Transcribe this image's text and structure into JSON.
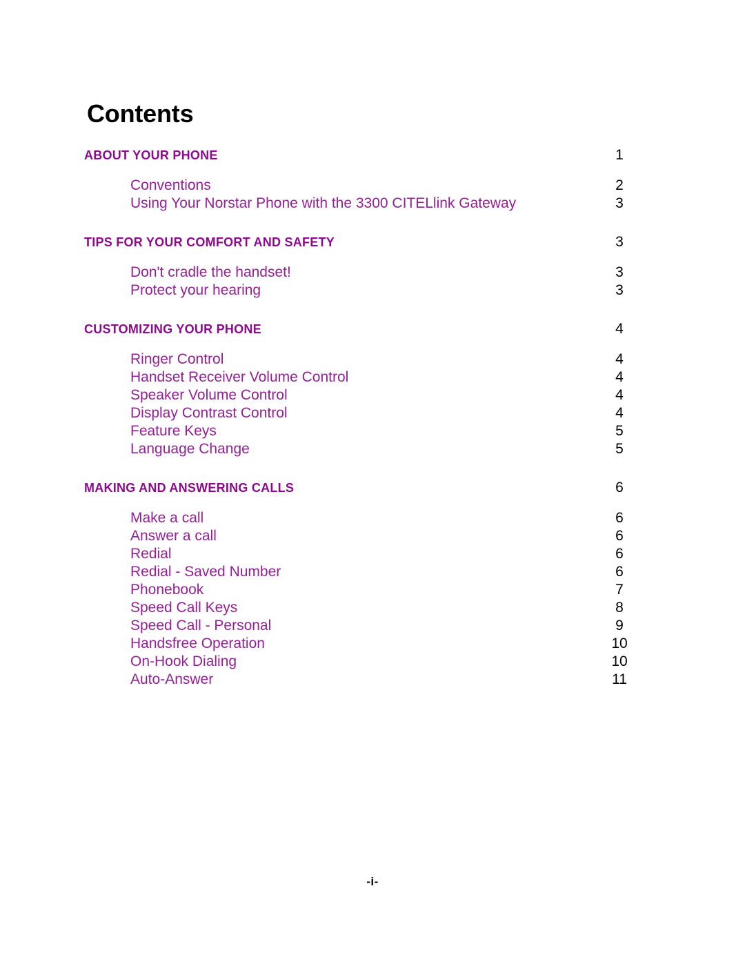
{
  "document": {
    "title": "Contents",
    "folio": "-i-"
  },
  "colors": {
    "heading": "#8C0A8C",
    "entry": "#932193",
    "page_number": "#000000",
    "title": "#000000",
    "background": "#FFFFFF"
  },
  "toc": {
    "sections": [
      {
        "heading": "ABOUT YOUR PHONE",
        "heading_page": "1",
        "entries": [
          {
            "label": "Conventions",
            "page": "2"
          },
          {
            "label": "Using Your Norstar Phone with the 3300 CITELlink Gateway",
            "page": "3"
          }
        ]
      },
      {
        "heading": "TIPS FOR YOUR COMFORT AND SAFETY",
        "heading_page": "3",
        "entries": [
          {
            "label": "Don't cradle the handset!",
            "page": "3"
          },
          {
            "label": "Protect your hearing",
            "page": "3"
          }
        ]
      },
      {
        "heading": "CUSTOMIZING YOUR PHONE",
        "heading_page": "4",
        "entries": [
          {
            "label": "Ringer Control",
            "page": "4"
          },
          {
            "label": "Handset Receiver Volume Control",
            "page": "4"
          },
          {
            "label": "Speaker Volume Control",
            "page": "4"
          },
          {
            "label": "Display Contrast Control",
            "page": "4"
          },
          {
            "label": "Feature Keys",
            "page": "5"
          },
          {
            "label": "Language Change",
            "page": "5"
          }
        ]
      },
      {
        "heading": "MAKING AND ANSWERING CALLS",
        "heading_page": "6",
        "entries": [
          {
            "label": "Make a call",
            "page": "6"
          },
          {
            "label": "Answer a call",
            "page": "6"
          },
          {
            "label": "Redial",
            "page": "6"
          },
          {
            "label": "Redial - Saved Number",
            "page": "6"
          },
          {
            "label": "Phonebook",
            "page": "7"
          },
          {
            "label": "Speed Call Keys",
            "page": "8"
          },
          {
            "label": "Speed Call - Personal",
            "page": "9"
          },
          {
            "label": "Handsfree Operation",
            "page": "10"
          },
          {
            "label": "On-Hook Dialing",
            "page": "10"
          },
          {
            "label": "Auto-Answer",
            "page": "11"
          }
        ]
      }
    ]
  }
}
